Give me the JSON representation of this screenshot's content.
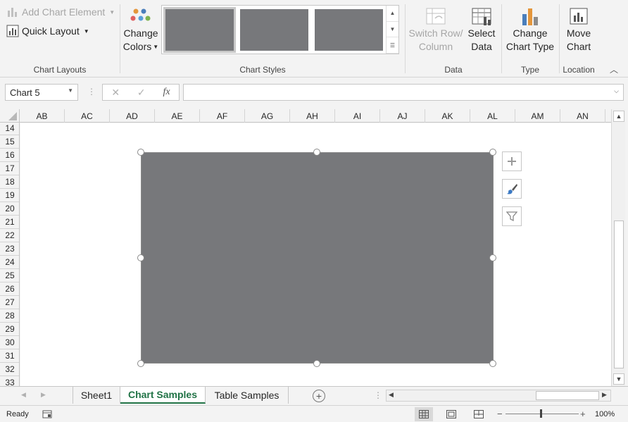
{
  "ribbon": {
    "chart_layouts": {
      "add_chart_element": "Add Chart Element",
      "quick_layout": "Quick Layout",
      "group_label": "Chart Layouts"
    },
    "chart_styles": {
      "change_colors_line1": "Change",
      "change_colors_line2": "Colors",
      "group_label": "Chart Styles"
    },
    "data": {
      "switch_row_line1": "Switch Row/",
      "switch_row_line2": "Column",
      "select_data_line1": "Select",
      "select_data_line2": "Data",
      "group_label": "Data"
    },
    "type": {
      "change_type_line1": "Change",
      "change_type_line2": "Chart Type",
      "group_label": "Type"
    },
    "location": {
      "move_chart_line1": "Move",
      "move_chart_line2": "Chart",
      "group_label": "Location"
    }
  },
  "formula_bar": {
    "name_box": "Chart 5",
    "fx_label": "fx",
    "formula": ""
  },
  "columns": [
    "AB",
    "AC",
    "AD",
    "AE",
    "AF",
    "AG",
    "AH",
    "AI",
    "AJ",
    "AK",
    "AL",
    "AM",
    "AN"
  ],
  "rows": [
    "14",
    "15",
    "16",
    "17",
    "18",
    "19",
    "20",
    "21",
    "22",
    "23",
    "24",
    "25",
    "26",
    "27",
    "28",
    "29",
    "30",
    "31",
    "32",
    "33"
  ],
  "tabs": {
    "sheet1": "Sheet1",
    "chart_samples": "Chart Samples",
    "table_samples": "Table Samples"
  },
  "status": {
    "ready": "Ready",
    "zoom": "100%"
  },
  "colors": {
    "accent_green": "#217346",
    "chart_fill": "#77787b"
  }
}
